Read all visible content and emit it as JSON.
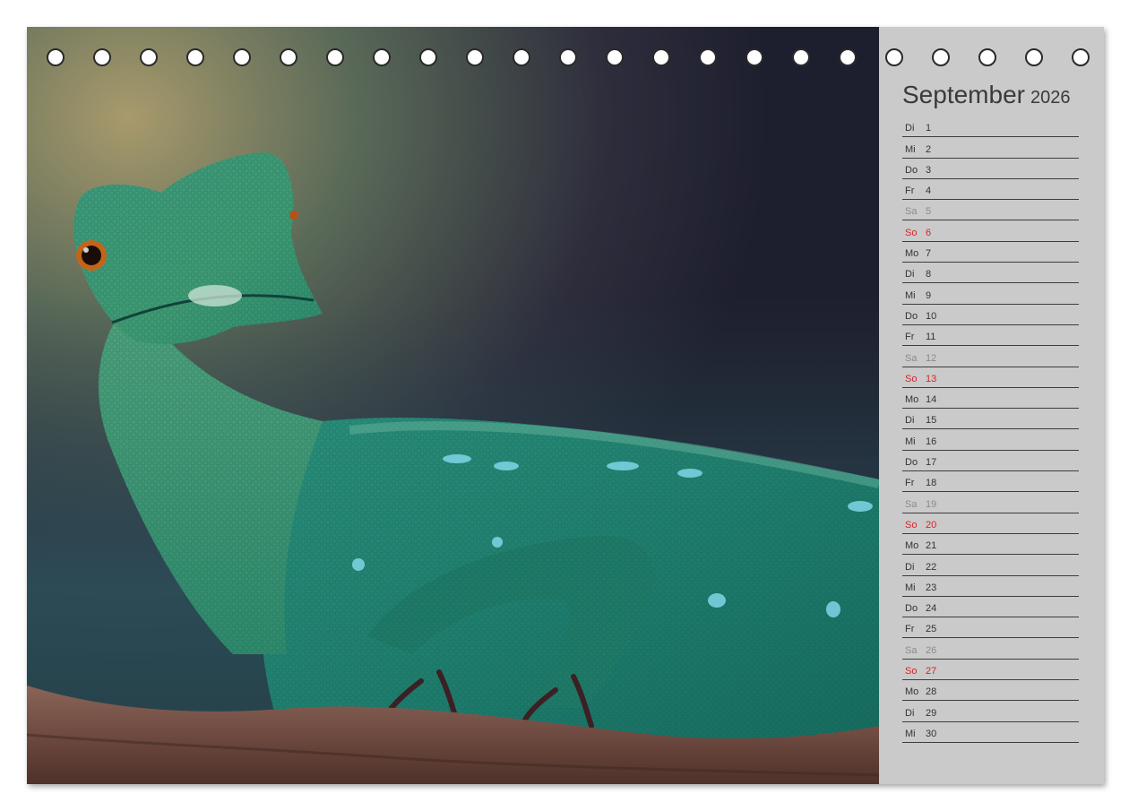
{
  "calendar": {
    "month": "September",
    "year": "2026",
    "days": [
      {
        "wd": "Di",
        "d": "1",
        "kind": "weekday"
      },
      {
        "wd": "Mi",
        "d": "2",
        "kind": "weekday"
      },
      {
        "wd": "Do",
        "d": "3",
        "kind": "weekday"
      },
      {
        "wd": "Fr",
        "d": "4",
        "kind": "weekday"
      },
      {
        "wd": "Sa",
        "d": "5",
        "kind": "sat"
      },
      {
        "wd": "So",
        "d": "6",
        "kind": "sun"
      },
      {
        "wd": "Mo",
        "d": "7",
        "kind": "weekday"
      },
      {
        "wd": "Di",
        "d": "8",
        "kind": "weekday"
      },
      {
        "wd": "Mi",
        "d": "9",
        "kind": "weekday"
      },
      {
        "wd": "Do",
        "d": "10",
        "kind": "weekday"
      },
      {
        "wd": "Fr",
        "d": "11",
        "kind": "weekday"
      },
      {
        "wd": "Sa",
        "d": "12",
        "kind": "sat"
      },
      {
        "wd": "So",
        "d": "13",
        "kind": "sun"
      },
      {
        "wd": "Mo",
        "d": "14",
        "kind": "weekday"
      },
      {
        "wd": "Di",
        "d": "15",
        "kind": "weekday"
      },
      {
        "wd": "Mi",
        "d": "16",
        "kind": "weekday"
      },
      {
        "wd": "Do",
        "d": "17",
        "kind": "weekday"
      },
      {
        "wd": "Fr",
        "d": "18",
        "kind": "weekday"
      },
      {
        "wd": "Sa",
        "d": "19",
        "kind": "sat"
      },
      {
        "wd": "So",
        "d": "20",
        "kind": "sun"
      },
      {
        "wd": "Mo",
        "d": "21",
        "kind": "weekday"
      },
      {
        "wd": "Di",
        "d": "22",
        "kind": "weekday"
      },
      {
        "wd": "Mi",
        "d": "23",
        "kind": "weekday"
      },
      {
        "wd": "Do",
        "d": "24",
        "kind": "weekday"
      },
      {
        "wd": "Fr",
        "d": "25",
        "kind": "weekday"
      },
      {
        "wd": "Sa",
        "d": "26",
        "kind": "sat"
      },
      {
        "wd": "So",
        "d": "27",
        "kind": "sun"
      },
      {
        "wd": "Mo",
        "d": "28",
        "kind": "weekday"
      },
      {
        "wd": "Di",
        "d": "29",
        "kind": "weekday"
      },
      {
        "wd": "Mi",
        "d": "30",
        "kind": "weekday"
      }
    ]
  },
  "colors": {
    "panel": "#cacaca",
    "sunday": "#d8232a",
    "saturday": "#8b8b8b",
    "text": "#333333",
    "lizard": "#2e8f78"
  },
  "binding_holes": 23
}
